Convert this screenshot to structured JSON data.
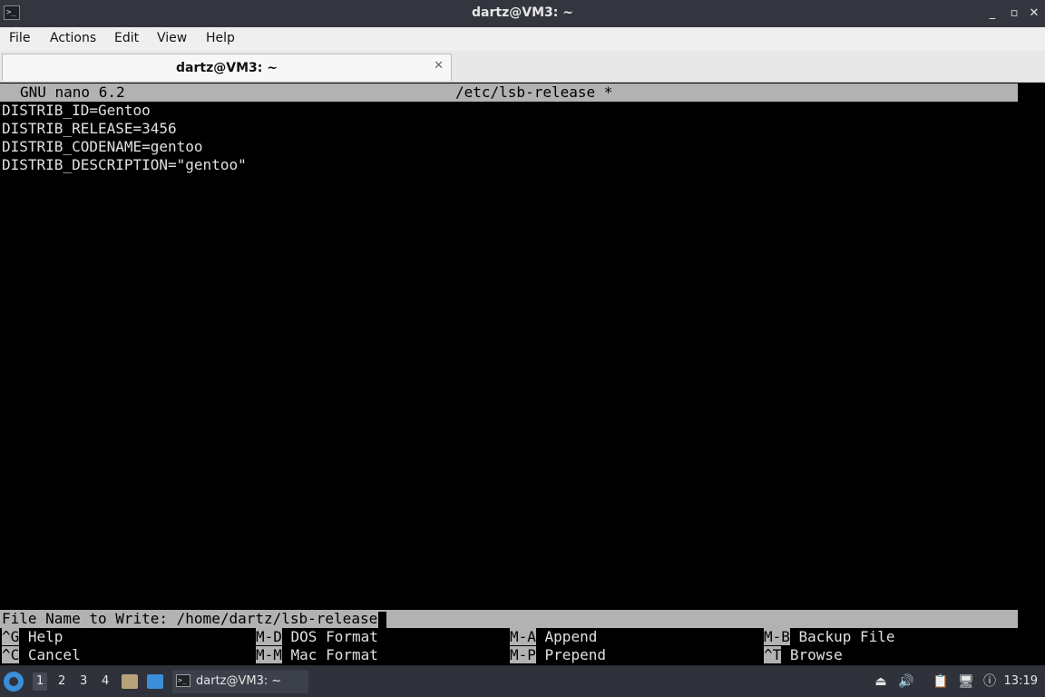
{
  "window": {
    "title": "dartz@VM3: ~",
    "app_icon": ">_",
    "controls": {
      "minimize": "_",
      "maximize": "▫",
      "close": "✕"
    }
  },
  "menu": [
    "File",
    "Actions",
    "Edit",
    "View",
    "Help"
  ],
  "tab": {
    "title": "dartz@VM3: ~",
    "close": "✕"
  },
  "nano": {
    "version": "GNU nano 6.2",
    "filename": "/etc/lsb-release *",
    "lines": [
      "DISTRIB_ID=Gentoo",
      "DISTRIB_RELEASE=3456",
      "DISTRIB_CODENAME=gentoo",
      "DISTRIB_DESCRIPTION=\"gentoo\""
    ],
    "prompt": "File Name to Write: /home/dartz/lsb-release",
    "shortcuts": [
      {
        "key": "^G",
        "label": " Help"
      },
      {
        "key": "M-D",
        "label": " DOS Format"
      },
      {
        "key": "M-A",
        "label": " Append"
      },
      {
        "key": "M-B",
        "label": " Backup File"
      },
      {
        "key": "^C",
        "label": " Cancel"
      },
      {
        "key": "M-M",
        "label": " Mac Format"
      },
      {
        "key": "M-P",
        "label": " Prepend"
      },
      {
        "key": "^T",
        "label": " Browse"
      }
    ]
  },
  "taskbar": {
    "workspaces": [
      "1",
      "2",
      "3",
      "4"
    ],
    "active_workspace": "1",
    "window_label": "dartz@VM3: ~",
    "clock": "13:19",
    "tray_icons": [
      "eject-icon",
      "volume-icon",
      "clipboard-icon",
      "network-icon",
      "notification-icon"
    ]
  },
  "colors": {
    "terminal_bg": "#000000",
    "terminal_fg": "#e0e0e0",
    "nano_bar": "#b2b2b2",
    "titlebar": "#33363f",
    "taskbar": "#2f323b",
    "accent": "#3a8fd8"
  }
}
